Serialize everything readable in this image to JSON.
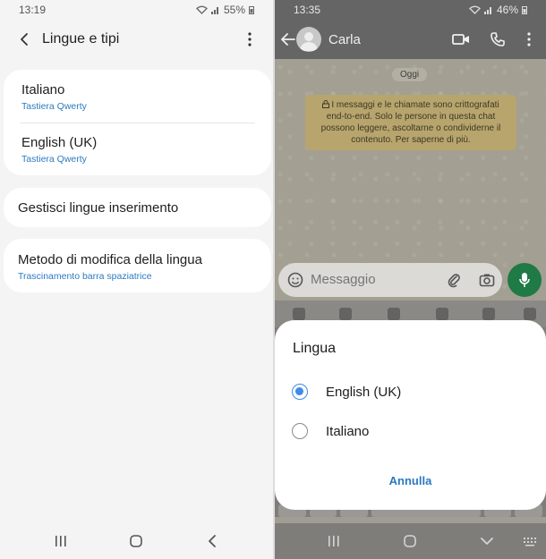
{
  "left": {
    "status": {
      "time": "13:19",
      "battery": "55%"
    },
    "header": {
      "title": "Lingue e tipi"
    },
    "languages": [
      {
        "name": "Italiano",
        "layout": "Tastiera Qwerty"
      },
      {
        "name": "English (UK)",
        "layout": "Tastiera Qwerty"
      }
    ],
    "manage": {
      "label": "Gestisci lingue inserimento"
    },
    "method": {
      "label": "Metodo di modifica della lingua",
      "value": "Trascinamento barra spaziatrice"
    }
  },
  "right": {
    "status": {
      "time": "13:35",
      "battery": "46%"
    },
    "chat": {
      "contact": "Carla",
      "date_pill": "Oggi",
      "e2e_notice": "I messaggi e le chiamate sono crittografati end-to-end. Solo le persone in questa chat possono leggere, ascoltarne o condividerne il contenuto. Per saperne di più."
    },
    "composer": {
      "placeholder": "Messaggio"
    },
    "dialog": {
      "title": "Lingua",
      "options": [
        {
          "label": "English (UK)",
          "selected": true
        },
        {
          "label": "Italiano",
          "selected": false
        }
      ],
      "cancel": "Annulla"
    }
  },
  "colors": {
    "accent_blue": "#2a78c2",
    "radio_selected": "#3e8be8",
    "mic_green": "#1f7a45",
    "sublabel_blue": "#2a7bbf"
  }
}
